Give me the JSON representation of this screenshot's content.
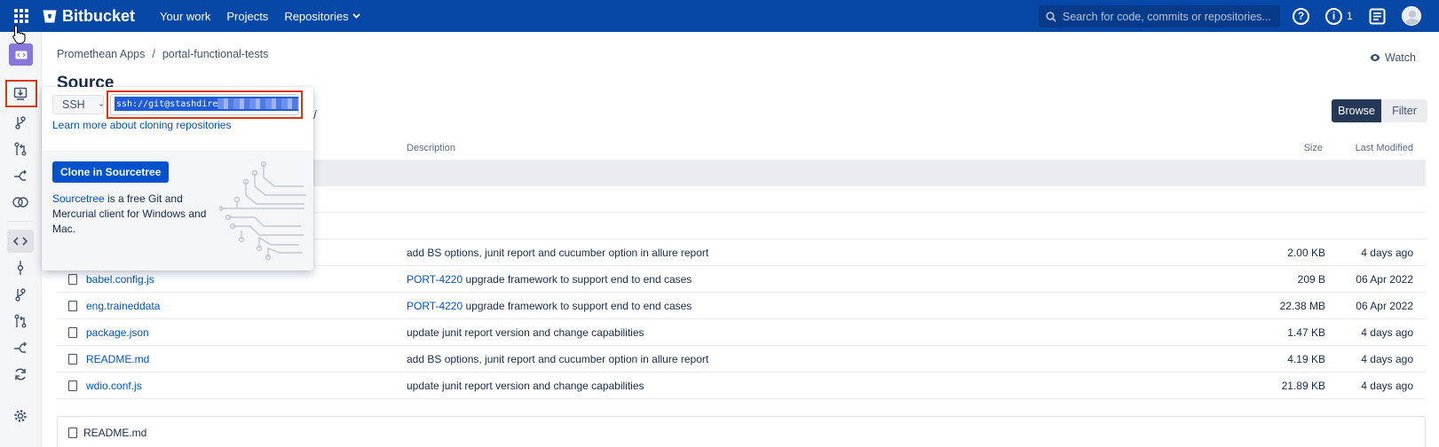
{
  "app": {
    "brand": "Bitbucket",
    "nav": [
      "Your work",
      "Projects",
      "Repositories"
    ],
    "search_placeholder": "Search for code, commits or repositories...",
    "notification_count": "1",
    "colors": {
      "topbar": "#0747a6",
      "accent": "#0052cc",
      "highlight": "#de350b"
    }
  },
  "sidebar": {
    "items": [
      "project-avatar",
      "clone",
      "create-branch",
      "create-pull-request",
      "fork",
      "compare",
      "source",
      "commits",
      "branches",
      "pull-requests",
      "forks",
      "builds",
      "settings"
    ]
  },
  "breadcrumb": {
    "project": "Promethean Apps",
    "separator": "/",
    "repo": "portal-functional-tests"
  },
  "watch_label": "Watch",
  "page_title": "Source",
  "path_slash": "/",
  "view_buttons": {
    "browse": "Browse",
    "filter": "Filter"
  },
  "table": {
    "headers": {
      "description": "Description",
      "size": "Size",
      "modified": "Last Modified"
    },
    "files": [
      {
        "name": "babel.config.js",
        "issue": "PORT-4220",
        "desc": " upgrade framework to support end to end cases",
        "size": "209 B",
        "modified": "06 Apr 2022"
      },
      {
        "name": "eng.traineddata",
        "issue": "PORT-4220",
        "desc": " upgrade framework to support end to end cases",
        "size": "22.38 MB",
        "modified": "06 Apr 2022"
      },
      {
        "name": "package.json",
        "issue": "",
        "desc": "update junit report version and change capabilities",
        "size": "1.47 KB",
        "modified": "4 days ago"
      },
      {
        "name": "README.md",
        "issue": "",
        "desc": "add BS options, junit report and cucumber option in allure report",
        "size": "4.19 KB",
        "modified": "4 days ago"
      },
      {
        "name": "wdio.conf.js",
        "issue": "",
        "desc": "update junit report version and change capabilities",
        "size": "21.89 KB",
        "modified": "4 days ago"
      }
    ],
    "partial_row": {
      "desc": "add BS options, junit report and cucumber option in allure report",
      "size": "2.00 KB",
      "modified": "4 days ago"
    }
  },
  "readme_label": "README.md",
  "clone_popup": {
    "protocol": "SSH",
    "url_visible": "ssh://git@stashdire",
    "learn_link": "Learn more about cloning repositories",
    "clone_button": "Clone in Sourcetree",
    "sourcetree_link": "Sourcetree",
    "sourcetree_text": " is a free Git and Mercurial client for Windows and Mac."
  }
}
